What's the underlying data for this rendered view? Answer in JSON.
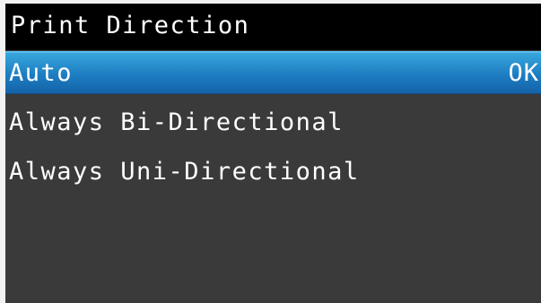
{
  "title": "Print Direction",
  "items": [
    {
      "label": "Auto",
      "status": "OK",
      "selected": true
    },
    {
      "label": "Always Bi-Directional",
      "selected": false
    },
    {
      "label": "Always Uni-Directional",
      "selected": false
    }
  ],
  "colors": {
    "screen_bg": "#3a3a3a",
    "title_bg": "#000000",
    "selected_bg": "#1d7dc2",
    "text": "#ffffff"
  }
}
